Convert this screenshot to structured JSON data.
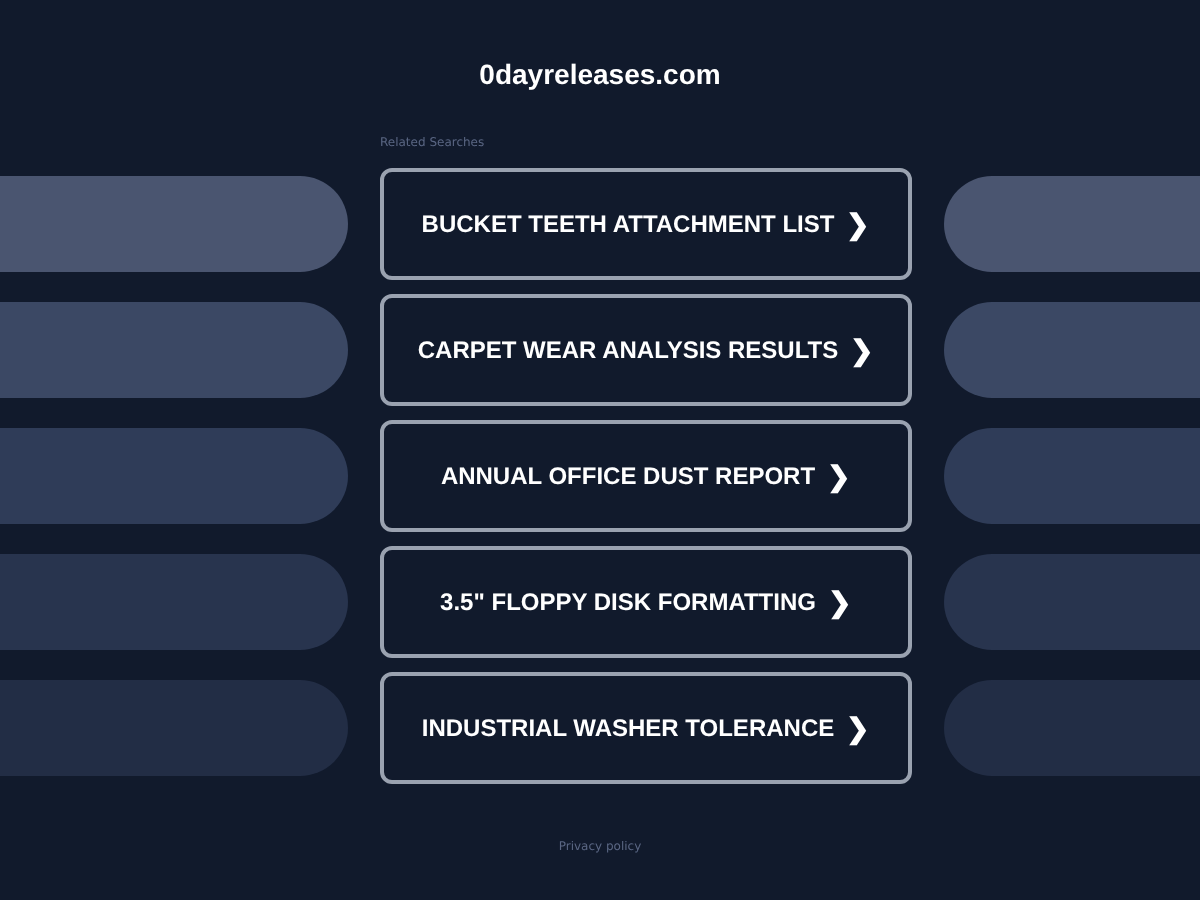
{
  "site_title": "0dayreleases.com",
  "related_label": "Related Searches",
  "searches": [
    {
      "label": "BUCKET TEETH ATTACHMENT LIST",
      "arrow": "❯"
    },
    {
      "label": "CARPET WEAR ANALYSIS RESULTS",
      "arrow": "❯"
    },
    {
      "label": "ANNUAL OFFICE DUST REPORT",
      "arrow": "❯"
    },
    {
      "label": "3.5\" FLOPPY DISK FORMATTING",
      "arrow": "❯"
    },
    {
      "label": "INDUSTRIAL WASHER TOLERANCE",
      "arrow": "❯"
    }
  ],
  "footer_link": "Privacy policy"
}
